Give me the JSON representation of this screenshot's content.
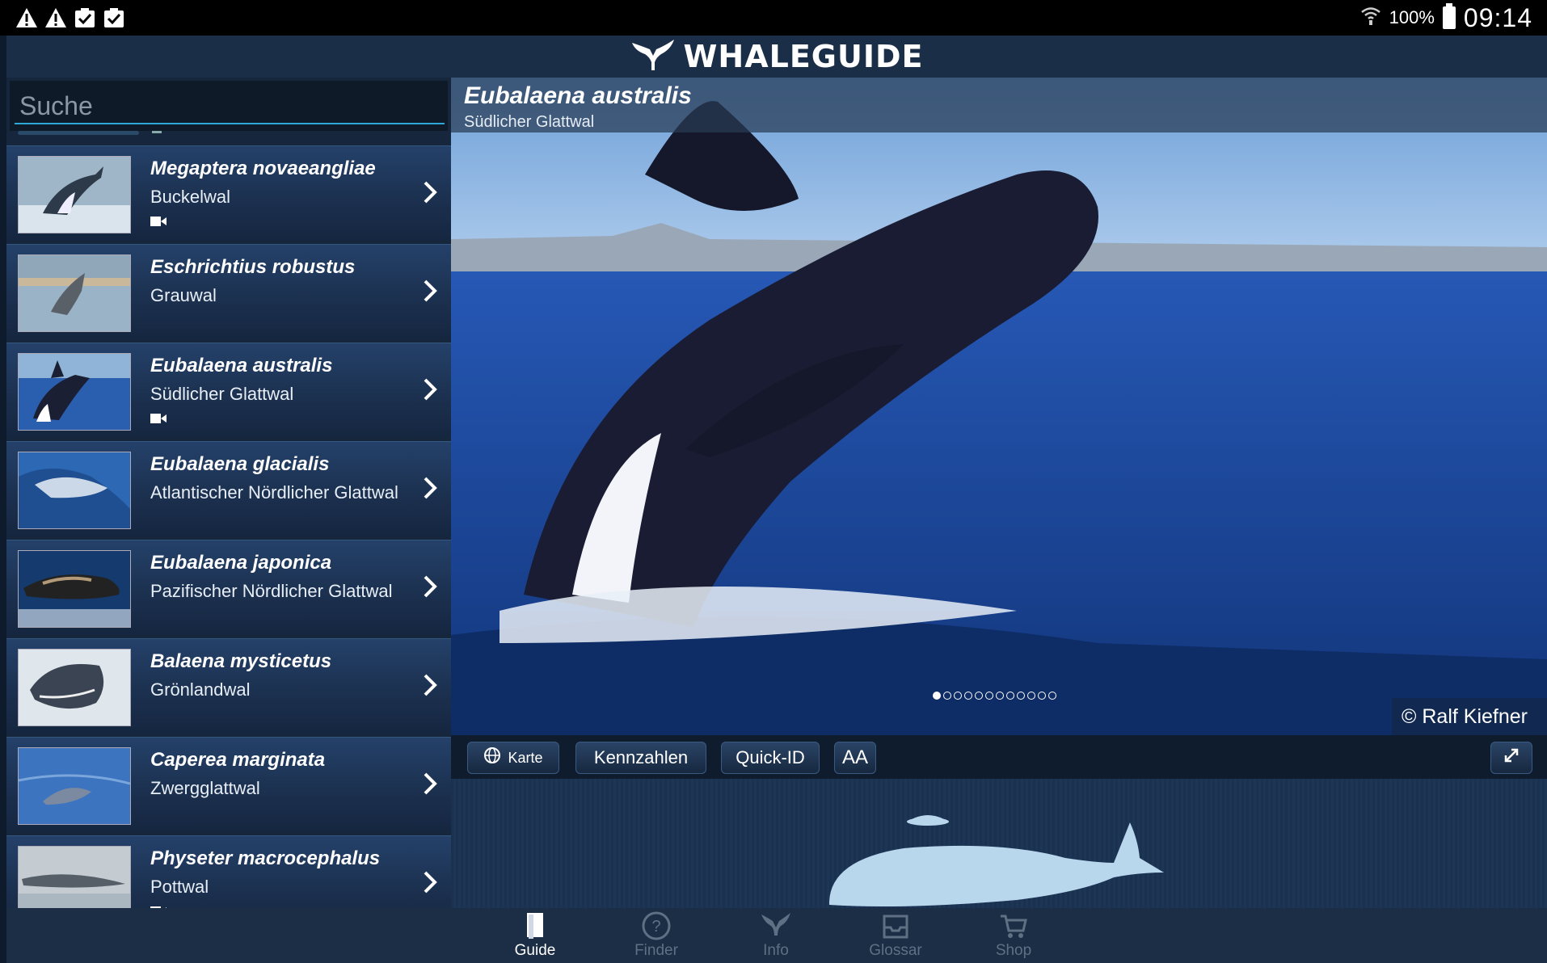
{
  "status_bar": {
    "battery": "100%",
    "time": "09:14",
    "icons": [
      "warning-icon",
      "warning-icon",
      "clipboard-check-icon",
      "clipboard-check-icon",
      "wifi-icon",
      "battery-icon"
    ]
  },
  "header": {
    "title": "WHALEGUIDE",
    "logo_icon": "whale-tail-icon"
  },
  "search": {
    "placeholder": "Suche",
    "value": ""
  },
  "species_list": [
    {
      "scientific": "Megaptera novaeangliae",
      "common": "Buckelwal",
      "has_video": true
    },
    {
      "scientific": "Eschrichtius robustus",
      "common": "Grauwal",
      "has_video": false
    },
    {
      "scientific": "Eubalaena australis",
      "common": "Südlicher Glattwal",
      "has_video": true
    },
    {
      "scientific": "Eubalaena glacialis",
      "common": "Atlantischer Nördlicher Glattwal",
      "has_video": false
    },
    {
      "scientific": "Eubalaena japonica",
      "common": "Pazifischer Nördlicher Glattwal",
      "has_video": false
    },
    {
      "scientific": "Balaena mysticetus",
      "common": "Grönlandwal",
      "has_video": false
    },
    {
      "scientific": "Caperea marginata",
      "common": "Zwergglattwal",
      "has_video": false
    },
    {
      "scientific": "Physeter macrocephalus",
      "common": "Pottwal",
      "has_video": true
    }
  ],
  "detail": {
    "scientific": "Eubalaena australis",
    "common": "Südlicher Glattwal",
    "copyright": "© Ralf Kiefner",
    "image_count": 12,
    "image_index": 1
  },
  "toolbar": {
    "karte": "Karte",
    "kennzahlen": "Kennzahlen",
    "quick_id": "Quick-ID",
    "font_size": "AA",
    "expand_icon": "expand-icon"
  },
  "nav": [
    {
      "label": "Guide",
      "icon": "book-icon",
      "active": true
    },
    {
      "label": "Finder",
      "icon": "globe-question-icon",
      "active": false
    },
    {
      "label": "Info",
      "icon": "whale-tail-icon",
      "active": false
    },
    {
      "label": "Glossar",
      "icon": "inbox-tray-icon",
      "active": false
    },
    {
      "label": "Shop",
      "icon": "cart-icon",
      "active": false
    }
  ],
  "colors": {
    "accent": "#2ea8d8",
    "panel": "#16263c",
    "header": "#1b2e47"
  }
}
